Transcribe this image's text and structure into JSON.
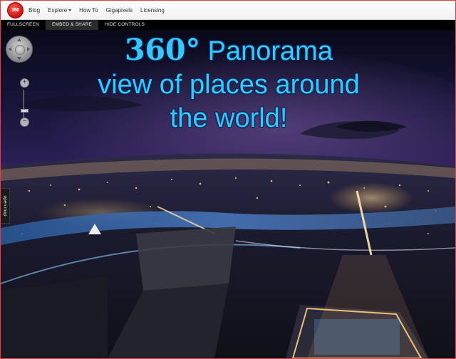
{
  "app": {
    "logo_text": "360",
    "brand_color": "#d01818",
    "frame_border_color": "#e24040"
  },
  "nav": {
    "items": [
      {
        "label": "Blog"
      },
      {
        "label": "Explore"
      },
      {
        "label": "How To"
      },
      {
        "label": "Gigapixels"
      },
      {
        "label": "Licensing"
      }
    ]
  },
  "viewer": {
    "toolbar": {
      "fullscreen": "FULLSCREEN",
      "embed_share": "EMBED & SHARE",
      "hide_controls": "HIDE CONTROLS"
    },
    "headline": {
      "line1_big": "360°",
      "line1_rest": " Panorama",
      "line2": "view of places around",
      "line3": "the world!",
      "color": "#35c7ff"
    },
    "open_map": "open map",
    "zoom_in": "+",
    "zoom_out": "−"
  }
}
